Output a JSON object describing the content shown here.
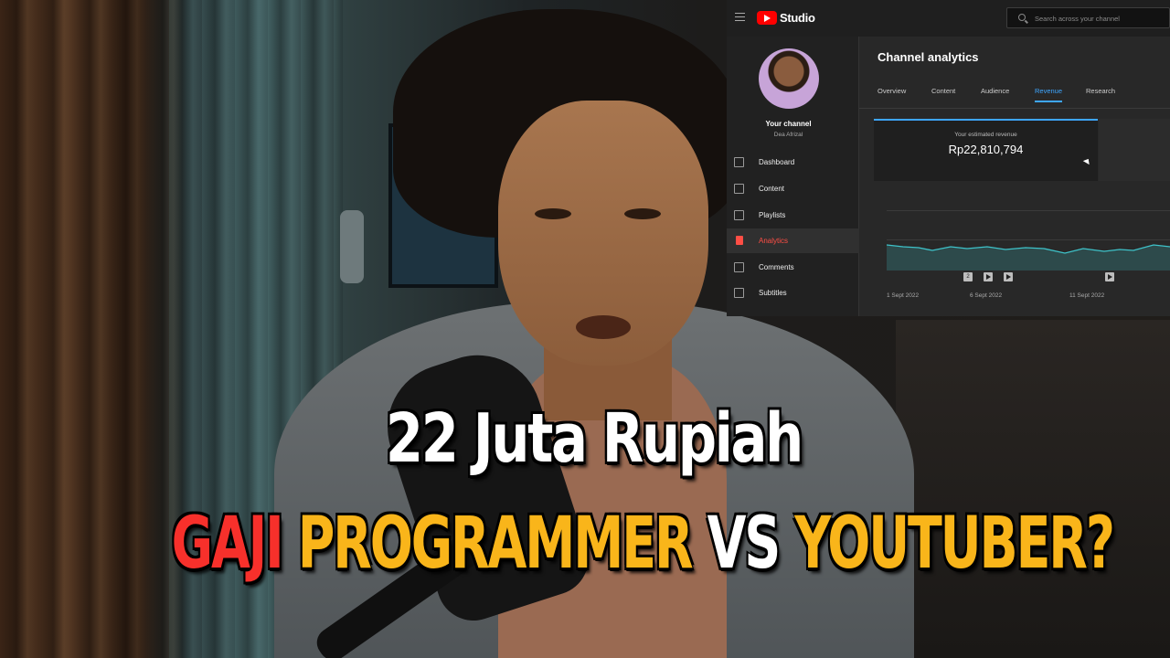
{
  "studio": {
    "logo_text": "Studio",
    "search": {
      "placeholder": "Search across your channel"
    },
    "sidebar": {
      "channel_label": "Your channel",
      "channel_name": "Dea Afrizal",
      "items": [
        {
          "label": "Dashboard",
          "icon": "dashboard-icon"
        },
        {
          "label": "Content",
          "icon": "content-icon"
        },
        {
          "label": "Playlists",
          "icon": "playlists-icon"
        },
        {
          "label": "Analytics",
          "icon": "analytics-icon",
          "active": true
        },
        {
          "label": "Comments",
          "icon": "comments-icon"
        },
        {
          "label": "Subtitles",
          "icon": "subtitles-icon"
        }
      ]
    },
    "main": {
      "title": "Channel analytics",
      "tabs": [
        {
          "label": "Overview"
        },
        {
          "label": "Content"
        },
        {
          "label": "Audience"
        },
        {
          "label": "Revenue",
          "active": true
        },
        {
          "label": "Research"
        }
      ],
      "revenue_card": {
        "label": "Your estimated revenue",
        "value": "Rp22,810,794"
      },
      "chart": {
        "x_labels": [
          "1 Sept 2022",
          "6 Sept 2022",
          "11 Sept 2022"
        ],
        "marker_badge": "2",
        "line_color": "#3ec2c9"
      }
    }
  },
  "captions": {
    "line1": "22 Juta Rupiah",
    "line2": {
      "word1": "GAJI",
      "word2": "PROGRAMMER",
      "word3": "VS",
      "word4": "YOUTUBER?"
    },
    "colors": {
      "red": "#f7302b",
      "yellow": "#f9b51a",
      "white": "#ffffff"
    }
  }
}
